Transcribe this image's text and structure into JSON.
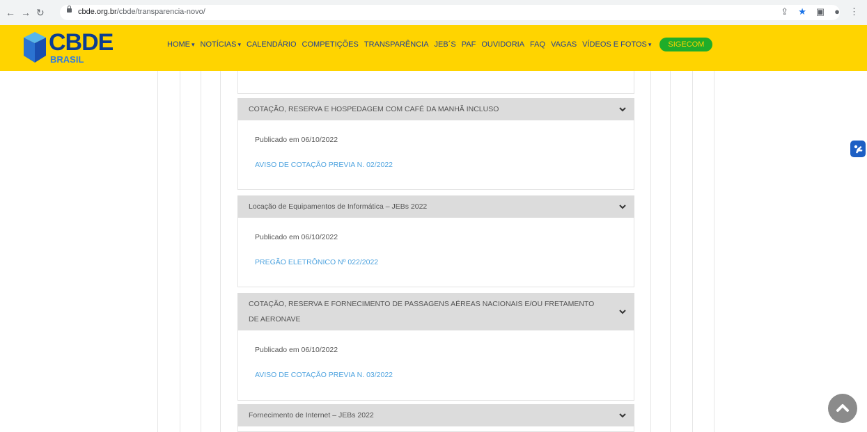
{
  "browser": {
    "url_domain": "cbde.org.br",
    "url_path": "/cbde/transparencia-novo/",
    "back_icon": "arrow-left-icon",
    "forward_icon": "arrow-right-icon",
    "reload_icon": "reload-icon"
  },
  "logo": {
    "main": "CBDE",
    "sub": "BRASIL"
  },
  "menu": {
    "home": "HOME",
    "noticias": "NOTÍCIAS",
    "calendario": "CALENDÁRIO",
    "competicoes": "COMPETIÇÕES",
    "transparencia": "TRANSPARÊNCIA",
    "jebs": "JEB´S",
    "paf": "PAF",
    "ouvidoria": "OUVIDORIA",
    "faq": "FAQ",
    "vagas": "VAGAS",
    "videos": "VÍDEOS E FOTOS",
    "sigecom": "SIGECOM"
  },
  "accordions": [
    {
      "title": "COTAÇÃO, RESERVA E HOSPEDAGEM COM CAFÉ DA MANHÃ INCLUSO",
      "published": "Publicado em 06/10/2022",
      "link": "AVISO DE COTAÇÃO PREVIA N. 02/2022"
    },
    {
      "title": "Locação de Equipamentos de Informática – JEBs 2022",
      "published": "Publicado em 06/10/2022",
      "link": "PREGÃO ELETRÔNICO Nº 022/2022"
    },
    {
      "title": "COTAÇÃO, RESERVA E FORNECIMENTO DE PASSAGENS AÉREAS NACIONAIS E/OU FRETAMENTO DE AERONAVE",
      "published": "Publicado em 06/10/2022",
      "link": "AVISO DE COTAÇÃO PREVIA N. 03/2022"
    },
    {
      "title": "Fornecimento de Internet – JEBs 2022"
    }
  ],
  "colors": {
    "header_bg": "#ffd400",
    "menu_text": "#1f3f95",
    "sigecom_bg": "#1fad2a",
    "accordion_header": "#dcdcdc",
    "link": "#4ea3df"
  }
}
